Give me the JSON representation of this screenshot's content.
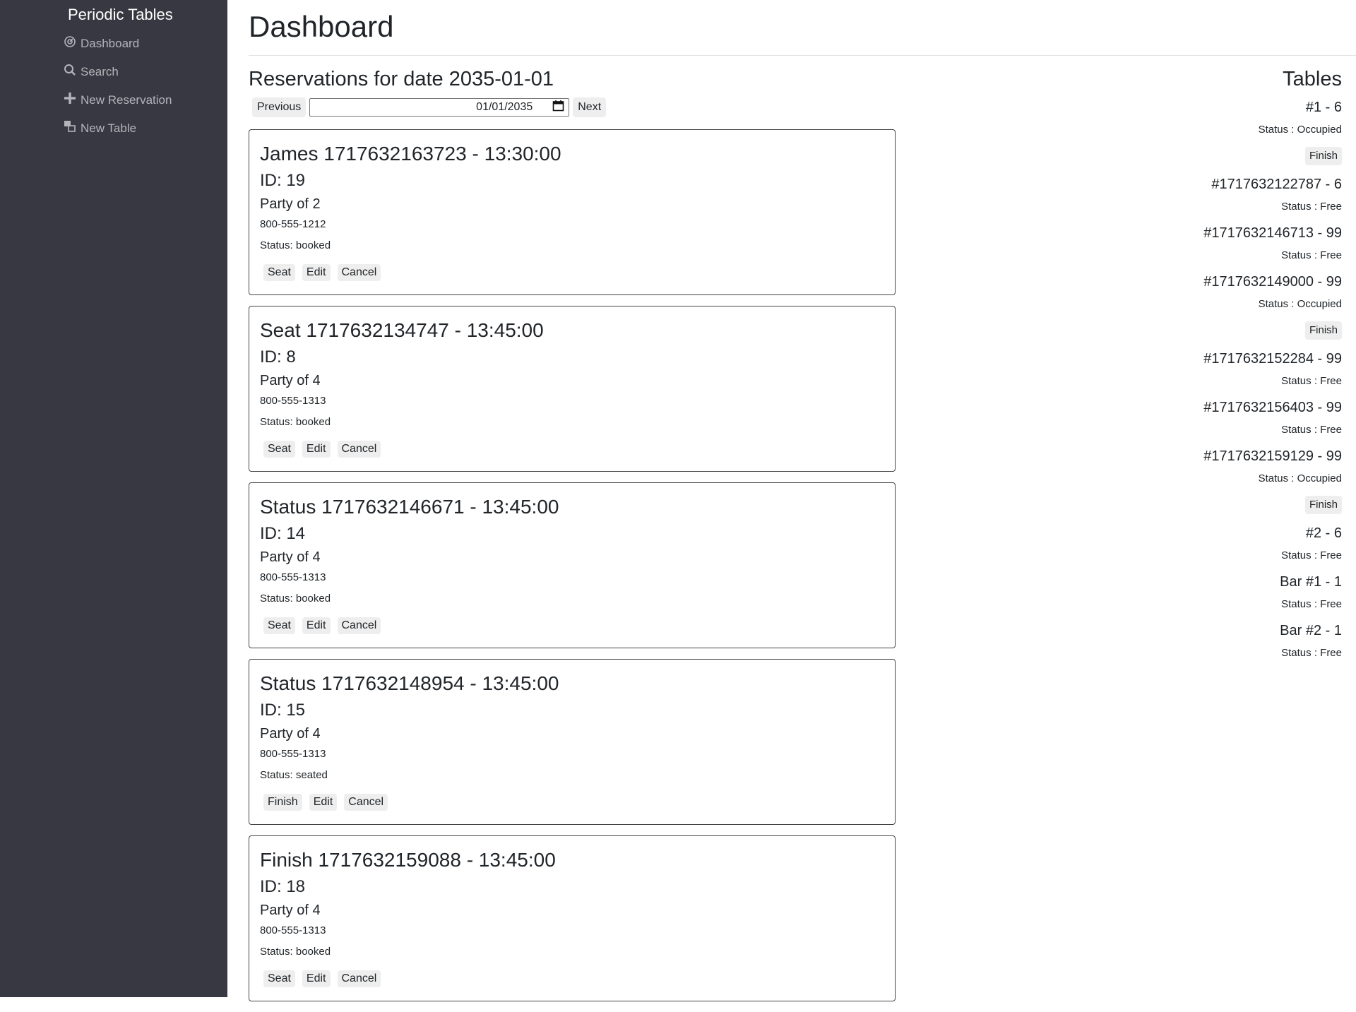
{
  "sidebar": {
    "brand": "Periodic Tables",
    "items": [
      {
        "label": "Dashboard",
        "icon": "dashboard-icon"
      },
      {
        "label": "Search",
        "icon": "search-icon"
      },
      {
        "label": "New Reservation",
        "icon": "plus-icon"
      },
      {
        "label": "New Table",
        "icon": "table-icon"
      }
    ]
  },
  "header": {
    "title": "Dashboard",
    "reservations_heading": "Reservations for date 2035-01-01",
    "previous_label": "Previous",
    "next_label": "Next",
    "date_value": "01/01/2035"
  },
  "reservations": [
    {
      "title": "James 1717632163723 - 13:30:00",
      "id": "ID: 19",
      "party": "Party of 2",
      "phone": "800-555-1212",
      "status": "Status: booked",
      "actions": [
        "Seat",
        "Edit",
        "Cancel"
      ]
    },
    {
      "title": "Seat 1717632134747 - 13:45:00",
      "id": "ID: 8",
      "party": "Party of 4",
      "phone": "800-555-1313",
      "status": "Status: booked",
      "actions": [
        "Seat",
        "Edit",
        "Cancel"
      ]
    },
    {
      "title": "Status 1717632146671 - 13:45:00",
      "id": "ID: 14",
      "party": "Party of 4",
      "phone": "800-555-1313",
      "status": "Status: booked",
      "actions": [
        "Seat",
        "Edit",
        "Cancel"
      ]
    },
    {
      "title": "Status 1717632148954 - 13:45:00",
      "id": "ID: 15",
      "party": "Party of 4",
      "phone": "800-555-1313",
      "status": "Status: seated",
      "actions": [
        "Finish",
        "Edit",
        "Cancel"
      ]
    },
    {
      "title": "Finish 1717632159088 - 13:45:00",
      "id": "ID: 18",
      "party": "Party of 4",
      "phone": "800-555-1313",
      "status": "Status: booked",
      "actions": [
        "Seat",
        "Edit",
        "Cancel"
      ]
    }
  ],
  "tables_panel": {
    "heading": "Tables",
    "finish_label": "Finish",
    "tables": [
      {
        "name": "#1 - 6",
        "status": "Status : Occupied",
        "occupied": true
      },
      {
        "name": "#1717632122787 - 6",
        "status": "Status : Free",
        "occupied": false
      },
      {
        "name": "#1717632146713 - 99",
        "status": "Status : Free",
        "occupied": false
      },
      {
        "name": "#1717632149000 - 99",
        "status": "Status : Occupied",
        "occupied": true
      },
      {
        "name": "#1717632152284 - 99",
        "status": "Status : Free",
        "occupied": false
      },
      {
        "name": "#1717632156403 - 99",
        "status": "Status : Free",
        "occupied": false
      },
      {
        "name": "#1717632159129 - 99",
        "status": "Status : Occupied",
        "occupied": true
      },
      {
        "name": "#2 - 6",
        "status": "Status : Free",
        "occupied": false
      },
      {
        "name": "Bar #1 - 1",
        "status": "Status : Free",
        "occupied": false
      },
      {
        "name": "Bar #2 - 1",
        "status": "Status : Free",
        "occupied": false
      }
    ]
  }
}
